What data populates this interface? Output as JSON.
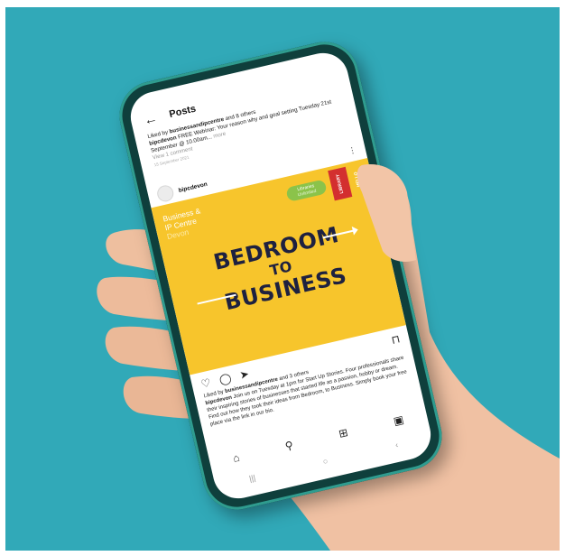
{
  "colors": {
    "background": "#31a9b8",
    "post_yellow": "#f7c52c",
    "headline_navy": "#1e2140",
    "phone_body": "#0f3f3c",
    "libraries_unlimited_green": "#8bc34a",
    "libraries_red": "#d32f2f",
    "skin": "#f3c9ae"
  },
  "app": {
    "back_icon": "arrow-left-icon",
    "title": "Posts"
  },
  "caption": {
    "liked_prefix": "Liked by",
    "liked_user": "businessandipcentre",
    "liked_suffix": "and 8 others",
    "user": "bipcdevon",
    "text": "FREE Webinar: Your reason why and goal setting Tuesday 21st September @ 10.00am...",
    "more": "more",
    "view_comments": "View 1 comment",
    "date": "15 September 2021"
  },
  "post_header": {
    "handle": "bipcdevon",
    "menu_icon": "more-vertical-icon"
  },
  "post_image": {
    "brand_line1": "Business &",
    "brand_line2": "IP Centre",
    "brand_line3": "Devon",
    "lu_line1": "Libraries",
    "lu_line2": "Unlimited",
    "libraries_badge": "LIBRARY HELLO",
    "headline_line1": "BEDROOM",
    "headline_line2": "TO",
    "headline_line3": "BUSINESS"
  },
  "actions": {
    "like_icon": "heart-icon",
    "comment_icon": "comment-icon",
    "share_icon": "send-icon",
    "save_icon": "bookmark-icon"
  },
  "post_caption": {
    "liked_prefix": "Liked by",
    "liked_user": "businessandipcentre",
    "liked_suffix": "and 3 others",
    "user": "bipcdevon",
    "text": "Join us on Tuesday at 1pm for Start Up Stories. Four professionals share their inspiring stories of businesses that started life as a passion, hobby or dream. Find out how they took their ideas from Bedroom, to Business. Simply book your free place via the link in our bio."
  },
  "bottom_nav": {
    "home_icon": "home-icon",
    "search_icon": "search-icon",
    "add_icon": "add-post-icon",
    "reels_icon": "reels-icon"
  },
  "system_nav": {
    "recents": "|||",
    "home": "○",
    "back": "‹"
  }
}
